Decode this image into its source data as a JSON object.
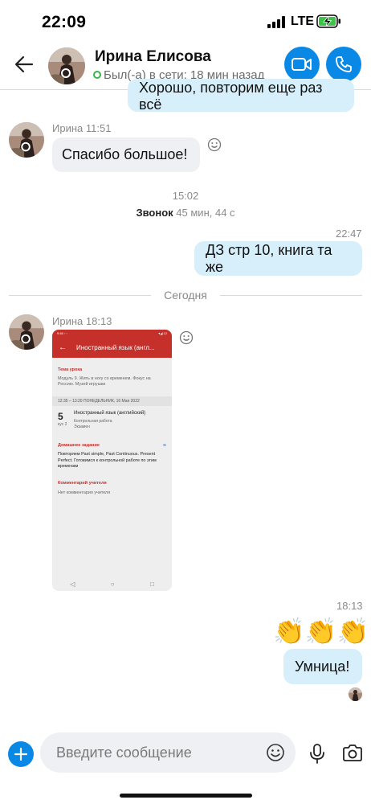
{
  "status_bar": {
    "time": "22:09",
    "network": "LTE",
    "icons": [
      "signal-bars-icon",
      "charging-battery-icon"
    ]
  },
  "header": {
    "contact_name": "Ирина Елисова",
    "presence": "Был(-а) в сети: 18 мин назад",
    "icons": [
      "back-arrow-icon",
      "video-camera-icon",
      "phone-icon"
    ],
    "accent_color": "#0a88e6"
  },
  "messages": {
    "out_1": {
      "text": "Хорошо, повторим еще раз всё"
    },
    "in_1": {
      "sender": "Ирина",
      "time": "11:51",
      "text": "Спасибо большое!"
    },
    "call_event": {
      "time": "15:02",
      "label": "Звонок",
      "duration": "45 мин, 44 с"
    },
    "out_2": {
      "time": "22:47",
      "text": "ДЗ стр 10, книга та же"
    },
    "date_divider": "Сегодня",
    "in_2": {
      "sender": "Ирина",
      "time": "18:13",
      "attachment": {
        "status_left": "9:46 ◦ ◦",
        "status_right": "▾◢ 12",
        "title": "Иностранный язык (англ...",
        "topic_label": "Тема урока",
        "topic_text": "Модуль 9. Жить в ногу со временем. Фокус на Россию. Музей игрушки",
        "time_band": "12:35 – 13:20   ПОНЕДЕЛЬНИК, 16 Мая 2022",
        "lesson_number": "5",
        "lesson_room": "кус 2",
        "lesson_title": "Иностранный язык (английский)",
        "lesson_tag_1": "Контрольная работа",
        "lesson_tag_2": "Экзамен",
        "homework_label": "Домашнее задание",
        "homework_text": "Повторяем Past simple, Past Continuous. Present Perfect. Готовимся к контрольной работе по этим временам",
        "comment_label": "Комментарий учителя",
        "comment_text": "Нет комментария учителя"
      }
    },
    "out_3": {
      "time": "18:13",
      "emojis": "👏👏👏",
      "text": "Умница!"
    }
  },
  "composer": {
    "placeholder": "Введите сообщение",
    "icons": [
      "plus-icon",
      "emoji-icon",
      "microphone-icon",
      "camera-icon"
    ]
  }
}
